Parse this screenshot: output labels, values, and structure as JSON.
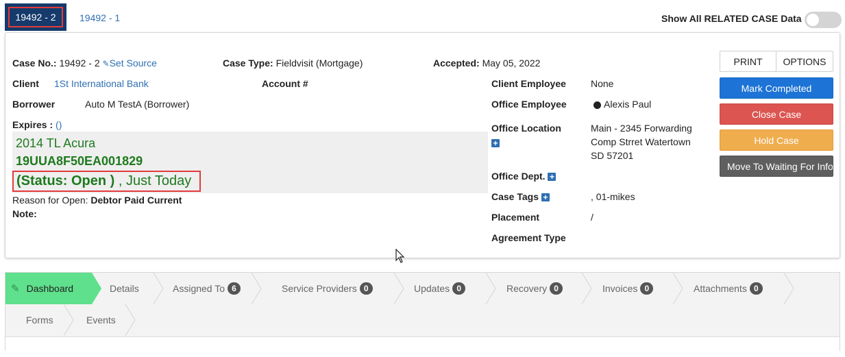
{
  "tabs": [
    {
      "label": "19492 - 2",
      "active": true
    },
    {
      "label": "19492 - 1",
      "active": false
    }
  ],
  "related_toggle": {
    "label": "Show All RELATED CASE Data",
    "on": false
  },
  "case": {
    "case_no_label": "Case No.:",
    "case_no": "19492 - 2",
    "set_source": "Set Source",
    "case_type_label": "Case Type:",
    "case_type": "Fieldvisit (Mortgage)",
    "accepted_label": "Accepted:",
    "accepted": "May 05, 2022",
    "client_label": "Client",
    "client": "1St International Bank",
    "account_label": "Account #",
    "borrower_label": "Borrower",
    "borrower": "Auto M TestA (Borrower)",
    "expires_label": "Expires :",
    "expires_value": "()",
    "vehicle_name": "2014 TL Acura",
    "vin": "19UUA8F50EA001829",
    "status": "(Status: Open )",
    "status_time": ", Just Today",
    "reason_label": "Reason for Open:",
    "reason": "Debtor Paid Current",
    "note_label": "Note:"
  },
  "details": {
    "client_employee_label": "Client Employee",
    "client_employee": "None",
    "office_employee_label": "Office Employee",
    "office_employee": "Alexis Paul",
    "office_location_label": "Office Location",
    "office_location_1": "Main - 2345 Forwarding",
    "office_location_2": "Comp Strret Watertown",
    "office_location_3": "SD 57201",
    "office_dept_label": "Office Dept.",
    "case_tags_label": "Case Tags",
    "case_tags": ", 01-mikes",
    "placement_label": "Placement",
    "placement": "/",
    "agreement_label": "Agreement Type"
  },
  "buttons": {
    "print": "PRINT",
    "options": "OPTIONS",
    "mark_completed": "Mark Completed",
    "close_case": "Close Case",
    "hold_case": "Hold Case",
    "move_waiting": "Move To Waiting For Info"
  },
  "nav": [
    {
      "label": "Dashboard"
    },
    {
      "label": "Details"
    },
    {
      "label": "Assigned To",
      "count": "6"
    },
    {
      "label": "Service Providers",
      "count": "0"
    },
    {
      "label": "Updates",
      "count": "0"
    },
    {
      "label": "Recovery",
      "count": "0"
    },
    {
      "label": "Invoices",
      "count": "0"
    },
    {
      "label": "Attachments",
      "count": "0"
    },
    {
      "label": "Forms"
    },
    {
      "label": "Events"
    }
  ],
  "colors": {
    "tab_active": "#153a6b",
    "link": "#2f6fb3",
    "status_green": "#1e7a1e",
    "mark_completed": "#1d73d6",
    "close_case": "#dc5551",
    "hold_case": "#f0ad4e",
    "move_waiting": "#5f5f5f",
    "dashboard_active": "#5ee08c"
  }
}
